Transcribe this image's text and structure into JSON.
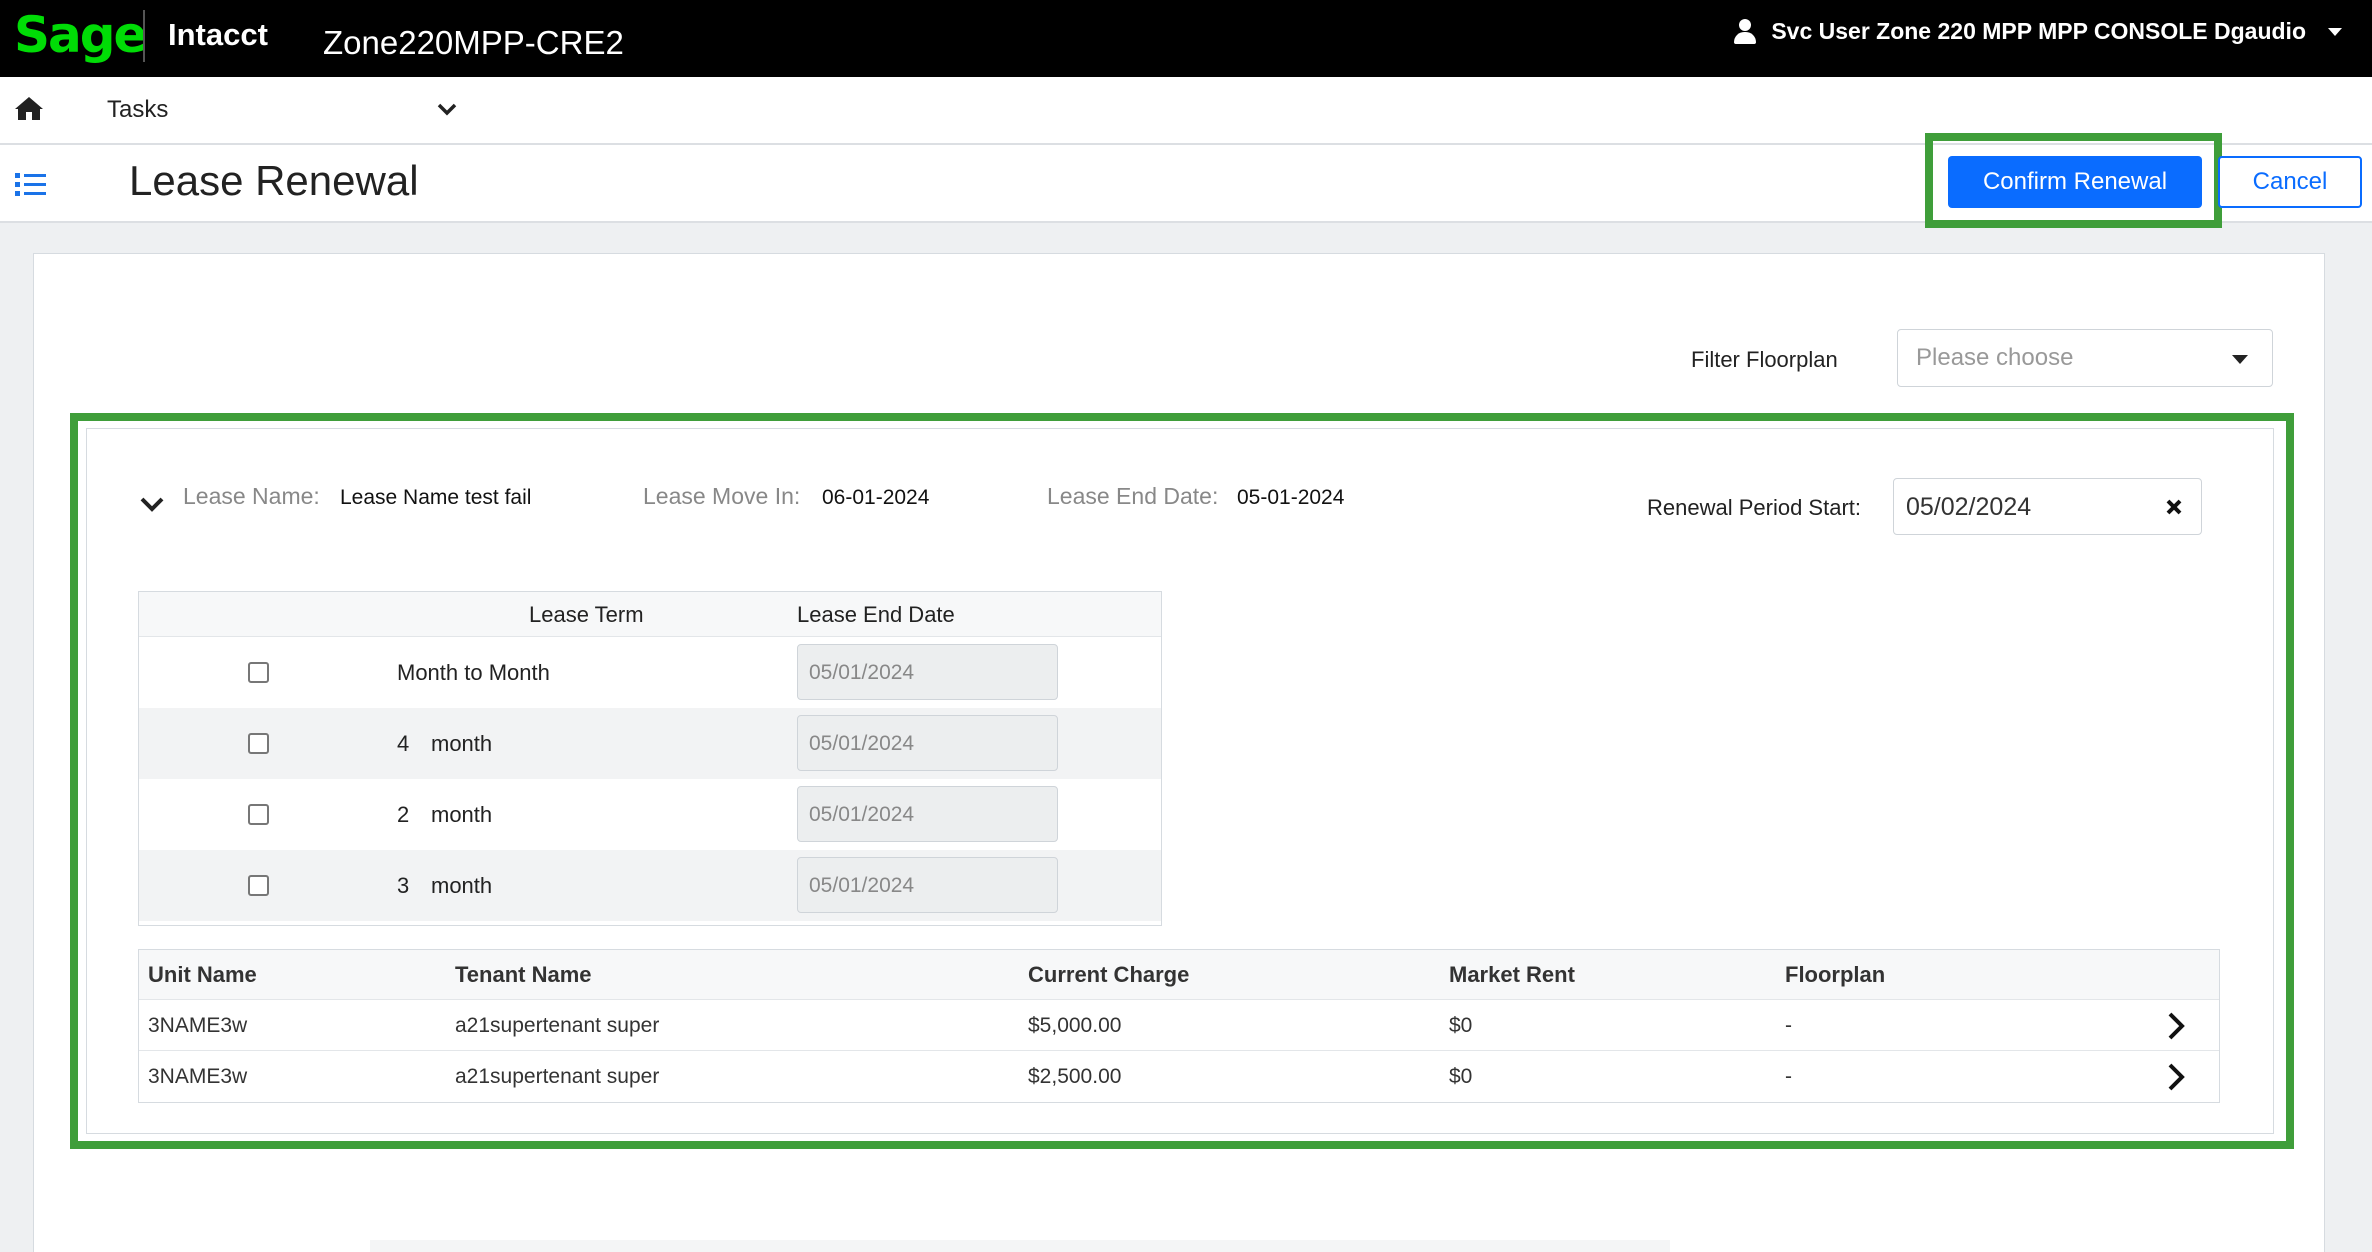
{
  "topbar": {
    "logo": "Sage",
    "product": "Intacct",
    "company": "Zone220MPP-CRE2",
    "user_name": "Svc User Zone 220 MPP MPP CONSOLE Dgaudio"
  },
  "navbar": {
    "home_icon": "home-icon",
    "tasks_label": "Tasks"
  },
  "header": {
    "title": "Lease Renewal",
    "confirm_label": "Confirm Renewal",
    "cancel_label": "Cancel",
    "highlight_color": "#3f9e3a",
    "accent_color": "#0a6cff"
  },
  "filter": {
    "label": "Filter Floorplan",
    "placeholder": "Please choose"
  },
  "lease": {
    "name_label": "Lease Name:",
    "name_value": "Lease Name test fail",
    "move_in_label": "Lease Move In:",
    "move_in_value": "06-01-2024",
    "end_date_label": "Lease End Date:",
    "end_date_value": "05-01-2024",
    "renewal_start_label": "Renewal Period Start:",
    "renewal_start_value": "05/02/2024"
  },
  "terms": {
    "headers": [
      "Lease Term",
      "Lease End Date"
    ],
    "rows": [
      {
        "num": "",
        "unit": "Month to Month",
        "end_date": "05/01/2024",
        "checked": false
      },
      {
        "num": "4",
        "unit": "month",
        "end_date": "05/01/2024",
        "checked": false
      },
      {
        "num": "2",
        "unit": "month",
        "end_date": "05/01/2024",
        "checked": false
      },
      {
        "num": "3",
        "unit": "month",
        "end_date": "05/01/2024",
        "checked": false
      }
    ]
  },
  "units": {
    "headers": [
      "Unit Name",
      "Tenant Name",
      "Current Charge",
      "Market Rent",
      "Floorplan"
    ],
    "rows": [
      [
        "3NAME3w",
        "a21supertenant super",
        "$5,000.00",
        "$0",
        "-"
      ],
      [
        "3NAME3w",
        "a21supertenant super",
        "$2,500.00",
        "$0",
        "-"
      ]
    ]
  }
}
